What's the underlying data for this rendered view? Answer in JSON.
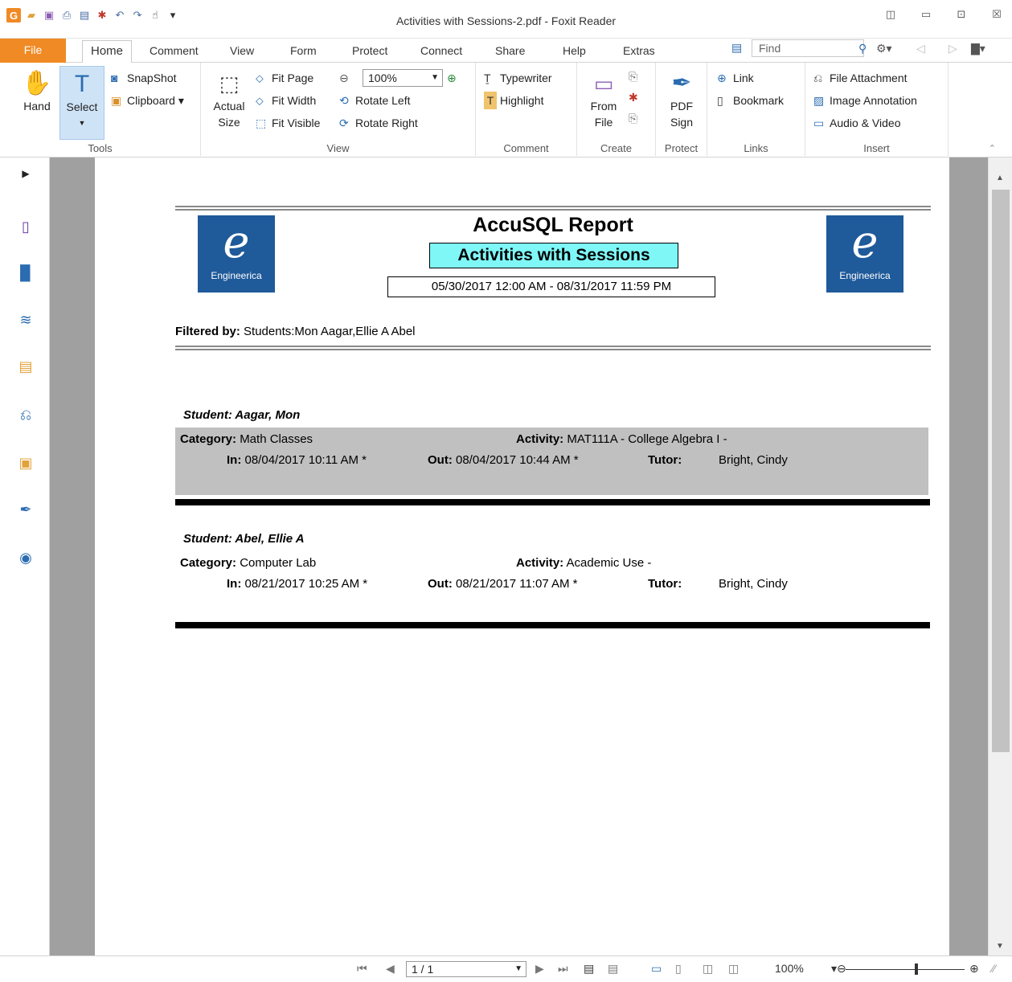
{
  "window": {
    "title": "Activities with Sessions-2.pdf - Foxit Reader",
    "app_icon": "foxit-icon",
    "controls": [
      "◫",
      "▭",
      "⊡",
      "☒"
    ]
  },
  "tabs": {
    "file": "File",
    "items": [
      "Home",
      "Comment",
      "View",
      "Form",
      "Protect",
      "Connect",
      "Share",
      "Help",
      "Extras"
    ],
    "find_placeholder": "Find"
  },
  "ribbon": {
    "tools": {
      "hand": "Hand",
      "select": "Select",
      "snapshot": "SnapShot",
      "clipboard": "Clipboard",
      "label": "Tools"
    },
    "view": {
      "actual_size_1": "Actual",
      "actual_size_2": "Size",
      "fit_page": "Fit Page",
      "fit_width": "Fit Width",
      "fit_visible": "Fit Visible",
      "zoom": "100%",
      "rotate_left": "Rotate Left",
      "rotate_right": "Rotate Right",
      "label": "View"
    },
    "comment": {
      "typewriter": "Typewriter",
      "highlight": "Highlight",
      "label": "Comment"
    },
    "create": {
      "from_file_1": "From",
      "from_file_2": "File",
      "label": "Create"
    },
    "protect": {
      "pdf_sign_1": "PDF",
      "pdf_sign_2": "Sign",
      "label": "Protect"
    },
    "links": {
      "link": "Link",
      "bookmark": "Bookmark",
      "label": "Links"
    },
    "insert": {
      "file_attachment": "File Attachment",
      "image_annotation": "Image Annotation",
      "audio_video": "Audio & Video",
      "label": "Insert"
    }
  },
  "report": {
    "title": "AccuSQL Report",
    "subtitle": "Activities with Sessions",
    "date_range": "05/30/2017 12:00 AM  -  08/31/2017 11:59 PM",
    "logo_text": "Engineerica",
    "filter_label": "Filtered by:",
    "filter_value": "Students:Mon  Aagar,Ellie A Abel",
    "records": [
      {
        "student": "Student: Aagar, Mon",
        "category_label": "Category:",
        "category": "Math Classes",
        "activity_label": "Activity:",
        "activity": "MAT111A - College Algebra I -",
        "in_label": "In:",
        "in": "08/04/2017 10:11 AM   *",
        "out_label": "Out:",
        "out": "08/04/2017 10:44 AM   *",
        "tutor_label": "Tutor:",
        "tutor": "Bright, Cindy"
      },
      {
        "student": "Student: Abel, Ellie A",
        "category_label": "Category:",
        "category": "Computer Lab",
        "activity_label": "Activity:",
        "activity": "Academic Use -",
        "in_label": "In:",
        "in": "08/21/2017 10:25 AM   *",
        "out_label": "Out:",
        "out": "08/21/2017 11:07 AM   *",
        "tutor_label": "Tutor:",
        "tutor": "Bright, Cindy"
      }
    ]
  },
  "status": {
    "page": "1 / 1",
    "zoom": "100%"
  }
}
